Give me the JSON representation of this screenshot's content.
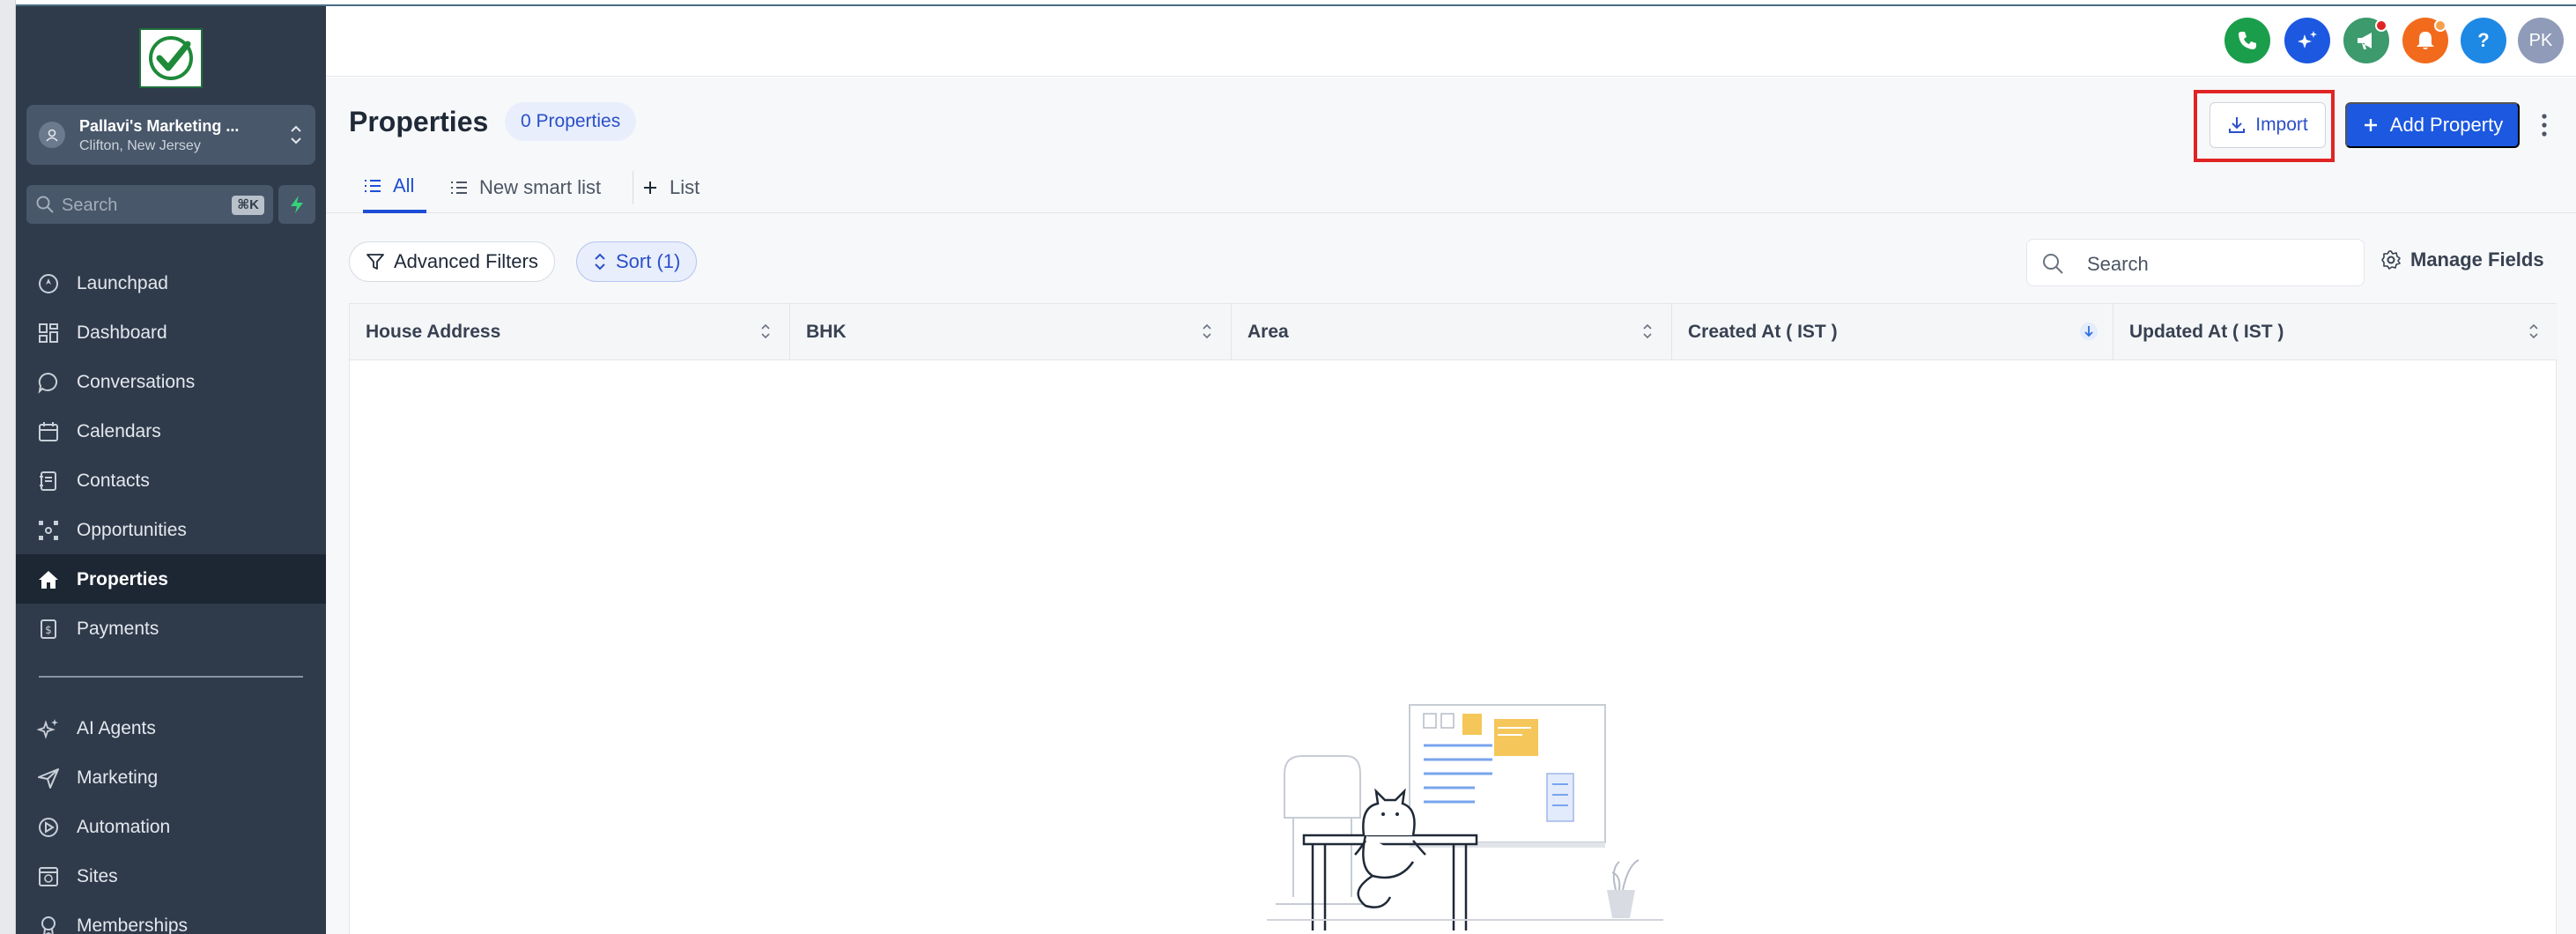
{
  "sidebar": {
    "account": {
      "name": "Pallavi's Marketing ...",
      "location": "Clifton, New Jersey"
    },
    "search": {
      "placeholder": "Search",
      "shortcut": "⌘K"
    },
    "items": [
      {
        "label": "Launchpad",
        "icon": "launchpad-icon"
      },
      {
        "label": "Dashboard",
        "icon": "dashboard-icon"
      },
      {
        "label": "Conversations",
        "icon": "chat-bubble-icon"
      },
      {
        "label": "Calendars",
        "icon": "calendar-icon"
      },
      {
        "label": "Contacts",
        "icon": "contact-book-icon"
      },
      {
        "label": "Opportunities",
        "icon": "opportunities-icon"
      },
      {
        "label": "Properties",
        "icon": "home-icon",
        "active": true
      },
      {
        "label": "Payments",
        "icon": "payments-icon"
      },
      {
        "label": "AI Agents",
        "icon": "sparkles-icon"
      },
      {
        "label": "Marketing",
        "icon": "send-icon"
      },
      {
        "label": "Automation",
        "icon": "automation-icon"
      },
      {
        "label": "Sites",
        "icon": "sites-icon"
      },
      {
        "label": "Memberships",
        "icon": "memberships-icon"
      }
    ]
  },
  "topbar": {
    "icons": [
      "phone-icon",
      "ai-sparkle-icon",
      "megaphone-icon",
      "bell-icon",
      "help-icon"
    ],
    "help_label": "?",
    "user_initials": "PK",
    "colors": {
      "phone": "#1a9e4b",
      "ai": "#1c58e0",
      "megaphone": "#3c9a6c",
      "bell": "#f26b1d",
      "help": "#1e88e5",
      "avatar": "#8f9bb8"
    }
  },
  "main": {
    "title": "Properties",
    "count_label": "0 Properties",
    "import_label": "Import",
    "add_label": "Add Property",
    "tabs": [
      {
        "label": "All",
        "active": true
      },
      {
        "label": "New smart list"
      },
      {
        "label": "List"
      }
    ],
    "filters": {
      "advanced_label": "Advanced Filters",
      "sort_label": "Sort (1)"
    },
    "search_placeholder": "Search",
    "manage_fields_label": "Manage Fields",
    "columns": [
      "House Address",
      "BHK",
      "Area",
      "Created At ( IST )",
      "Updated At ( IST )"
    ]
  },
  "colors": {
    "sidebar_bg": "#2f3b4b",
    "primary": "#1c58e0",
    "highlight_border": "#e02424"
  }
}
